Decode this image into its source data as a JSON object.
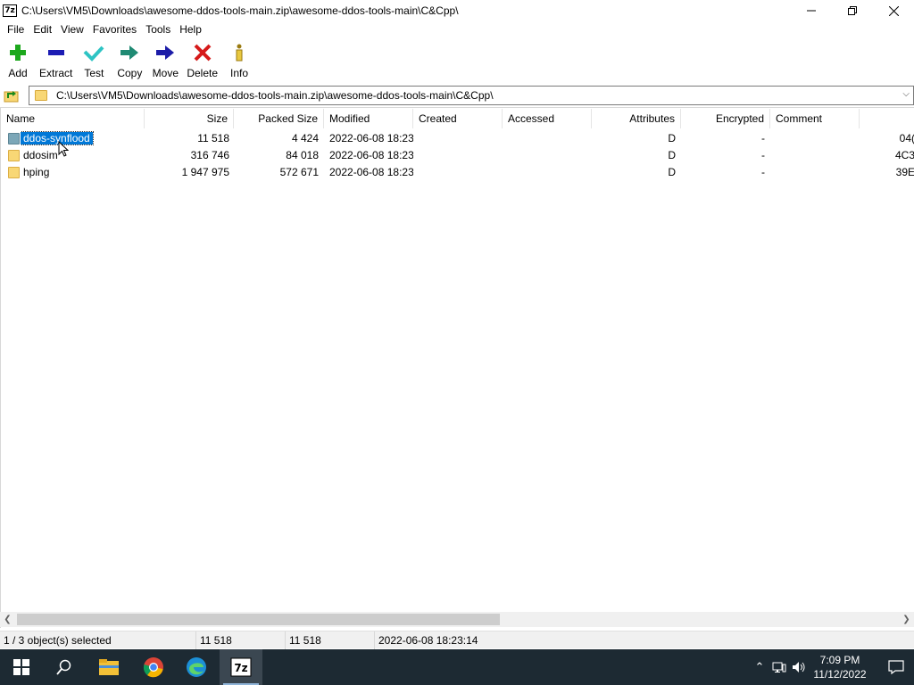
{
  "window": {
    "app_icon": "7z",
    "title": "C:\\Users\\VM5\\Downloads\\awesome-ddos-tools-main.zip\\awesome-ddos-tools-main\\C&Cpp\\",
    "controls": {
      "minimize": "minimize-icon",
      "maximize": "restore-icon",
      "close": "close-icon"
    }
  },
  "menu": [
    "File",
    "Edit",
    "View",
    "Favorites",
    "Tools",
    "Help"
  ],
  "toolbar": [
    {
      "label": "Add",
      "icon": "plus-icon"
    },
    {
      "label": "Extract",
      "icon": "minus-icon"
    },
    {
      "label": "Test",
      "icon": "check-icon"
    },
    {
      "label": "Copy",
      "icon": "copy-arrow-icon"
    },
    {
      "label": "Move",
      "icon": "move-arrow-icon"
    },
    {
      "label": "Delete",
      "icon": "delete-x-icon"
    },
    {
      "label": "Info",
      "icon": "info-icon"
    }
  ],
  "address": {
    "path": "C:\\Users\\VM5\\Downloads\\awesome-ddos-tools-main.zip\\awesome-ddos-tools-main\\C&Cpp\\"
  },
  "columns": [
    "Name",
    "Size",
    "Packed Size",
    "Modified",
    "Created",
    "Accessed",
    "Attributes",
    "Encrypted",
    "Comment"
  ],
  "files": [
    {
      "name": "ddos-synflood",
      "size": "11 518",
      "packed": "4 424",
      "modified": "2022-06-08 18:23",
      "created": "",
      "accessed": "",
      "attributes": "D",
      "encrypted": "-",
      "comment": "",
      "crc": "04(",
      "selected": true
    },
    {
      "name": "ddosim",
      "size": "316 746",
      "packed": "84 018",
      "modified": "2022-06-08 18:23",
      "created": "",
      "accessed": "",
      "attributes": "D",
      "encrypted": "-",
      "comment": "",
      "crc": "4C3",
      "selected": false
    },
    {
      "name": "hping",
      "size": "1 947 975",
      "packed": "572 671",
      "modified": "2022-06-08 18:23",
      "created": "",
      "accessed": "",
      "attributes": "D",
      "encrypted": "-",
      "comment": "",
      "crc": "39E",
      "selected": false
    }
  ],
  "status": {
    "selection": "1 / 3 object(s) selected",
    "size": "11 518",
    "packed": "11 518",
    "modified": "2022-06-08 18:23:14"
  },
  "taskbar": {
    "items": [
      "windows-start-icon",
      "search-icon",
      "file-explorer-icon",
      "chrome-icon",
      "edge-icon",
      "7zip-icon"
    ],
    "time": "7:09 PM",
    "date": "11/12/2022"
  },
  "colors": {
    "selection": "#0078d7",
    "folder": "#f8d775",
    "taskbar": "#1d2a33"
  }
}
